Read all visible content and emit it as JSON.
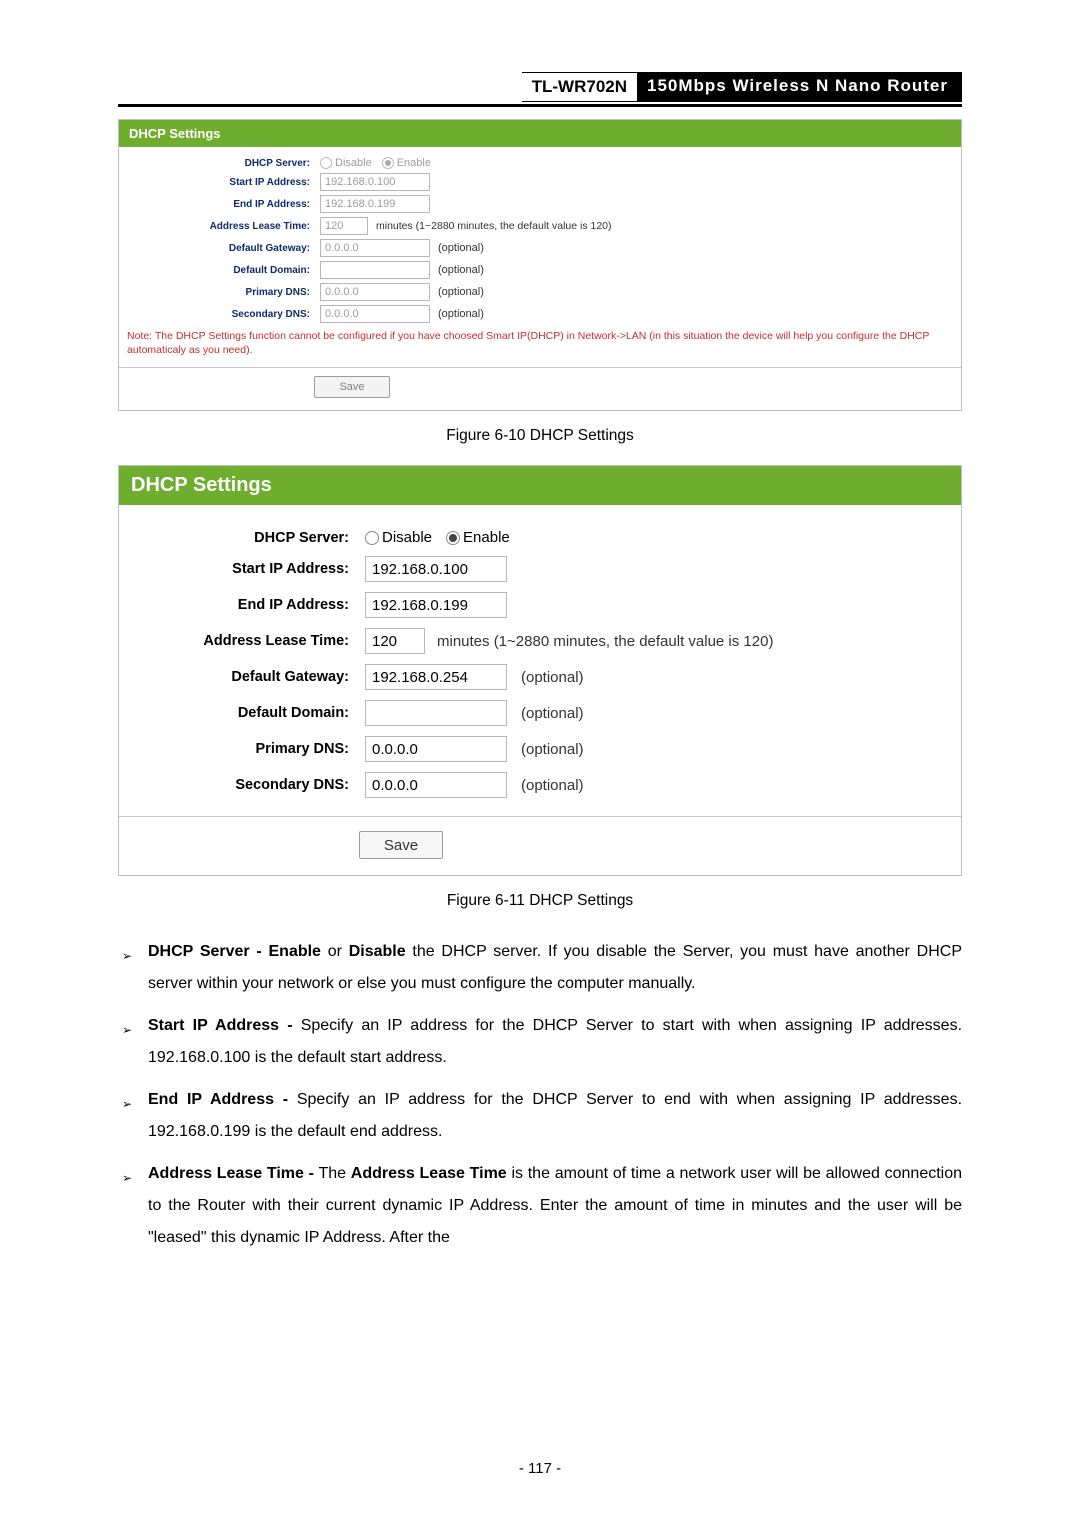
{
  "header": {
    "model": "TL-WR702N",
    "product": "150Mbps Wireless N Nano Router"
  },
  "panel1": {
    "title": "DHCP Settings",
    "dhcp_server_label": "DHCP Server:",
    "disable": "Disable",
    "enable": "Enable",
    "start_ip_label": "Start IP Address:",
    "start_ip": "192.168.0.100",
    "end_ip_label": "End IP Address:",
    "end_ip": "192.168.0.199",
    "lease_label": "Address Lease Time:",
    "lease_val": "120",
    "lease_hint": "minutes (1~2880 minutes, the default value is 120)",
    "gateway_label": "Default Gateway:",
    "gateway": "0.0.0.0",
    "domain_label": "Default Domain:",
    "domain": "",
    "pdns_label": "Primary DNS:",
    "pdns": "0.0.0.0",
    "sdns_label": "Secondary DNS:",
    "sdns": "0.0.0.0",
    "optional": "(optional)",
    "note": "Note: The DHCP Settings function cannot be configured if you have choosed Smart IP(DHCP) in Network->LAN (in this situation the device will help you configure the DHCP automaticaly as you need).",
    "save": "Save"
  },
  "caption1": "Figure 6-10 DHCP Settings",
  "panel2": {
    "title": "DHCP Settings",
    "dhcp_server_label": "DHCP Server:",
    "disable": "Disable",
    "enable": "Enable",
    "start_ip_label": "Start IP Address:",
    "start_ip": "192.168.0.100",
    "end_ip_label": "End IP Address:",
    "end_ip": "192.168.0.199",
    "lease_label": "Address Lease Time:",
    "lease_val": "120",
    "lease_hint": "minutes (1~2880 minutes, the default value is 120)",
    "gateway_label": "Default Gateway:",
    "gateway": "192.168.0.254",
    "domain_label": "Default Domain:",
    "domain": "",
    "pdns_label": "Primary DNS:",
    "pdns": "0.0.0.0",
    "sdns_label": "Secondary DNS:",
    "sdns": "0.0.0.0",
    "optional": "(optional)",
    "save": "Save"
  },
  "caption2": "Figure 6-11 DHCP Settings",
  "descr": {
    "item1_b": "DHCP Server - Enable",
    "item1_mid": " or ",
    "item1_b2": "Disable",
    "item1_rest": " the DHCP server. If you disable the Server, you must have another DHCP server within your network or else you must configure the computer manually.",
    "item2_b": "Start IP Address -",
    "item2_rest": " Specify an IP address for the DHCP Server to start with when assigning IP addresses. 192.168.0.100 is the default start address.",
    "item3_b": "End IP Address -",
    "item3_rest": " Specify an IP address for the DHCP Server to end with when assigning IP addresses. 192.168.0.199 is the default end address.",
    "item4_b": "Address Lease Time -",
    "item4_mid": " The ",
    "item4_b2": "Address Lease Time",
    "item4_rest": " is the amount of time a network user will be allowed connection to the Router with their current dynamic IP Address. Enter the amount of time in minutes and the user will be \"leased\" this dynamic IP Address. After the"
  },
  "page_no": "- 117 -"
}
